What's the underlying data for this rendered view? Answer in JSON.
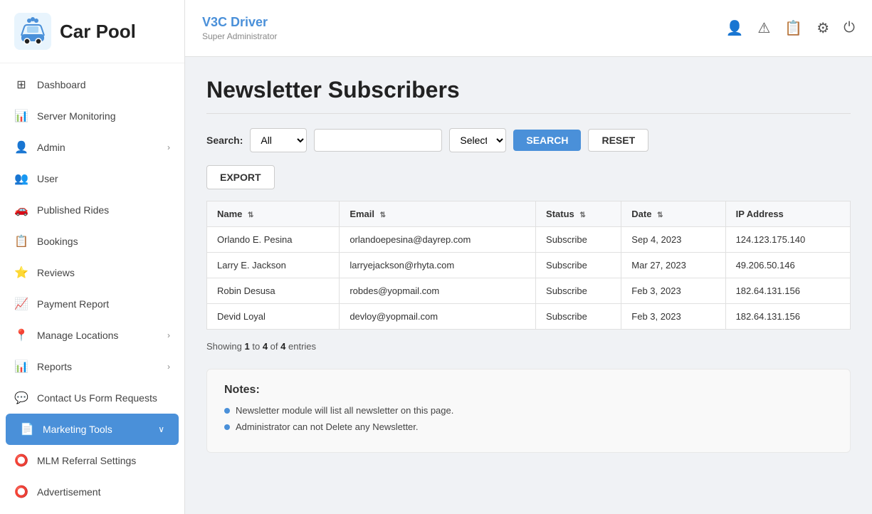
{
  "app": {
    "title": "Car Pool"
  },
  "header": {
    "driver_name": "V3C Driver",
    "role": "Super Administrator"
  },
  "sidebar": {
    "items": [
      {
        "id": "dashboard",
        "label": "Dashboard",
        "icon": "⊞",
        "active": false
      },
      {
        "id": "server-monitoring",
        "label": "Server Monitoring",
        "icon": "📊",
        "active": false
      },
      {
        "id": "admin",
        "label": "Admin",
        "icon": "👤",
        "active": false,
        "has_arrow": true
      },
      {
        "id": "user",
        "label": "User",
        "icon": "👥",
        "active": false
      },
      {
        "id": "published-rides",
        "label": "Published Rides",
        "icon": "🚗",
        "active": false
      },
      {
        "id": "bookings",
        "label": "Bookings",
        "icon": "📋",
        "active": false
      },
      {
        "id": "reviews",
        "label": "Reviews",
        "icon": "👤",
        "active": false
      },
      {
        "id": "payment-report",
        "label": "Payment Report",
        "icon": "📈",
        "active": false
      },
      {
        "id": "manage-locations",
        "label": "Manage Locations",
        "icon": "📍",
        "active": false,
        "has_arrow": true
      },
      {
        "id": "reports",
        "label": "Reports",
        "icon": "📊",
        "active": false,
        "has_arrow": true
      },
      {
        "id": "contact-us",
        "label": "Contact Us Form Requests",
        "icon": "💬",
        "active": false
      },
      {
        "id": "marketing-tools",
        "label": "Marketing Tools",
        "icon": "📄",
        "active": true,
        "has_arrow": true
      },
      {
        "id": "mlm-referral",
        "label": "MLM Referral Settings",
        "icon": "⭕",
        "active": false
      },
      {
        "id": "advertisement",
        "label": "Advertisement",
        "icon": "⭕",
        "active": false
      }
    ]
  },
  "page": {
    "title": "Newsletter Subscribers"
  },
  "search": {
    "label": "Search:",
    "all_option": "All",
    "select_status_placeholder": "Select Status",
    "search_button": "SEARCH",
    "reset_button": "RESET",
    "export_button": "EXPORT"
  },
  "table": {
    "columns": [
      {
        "id": "name",
        "label": "Name",
        "sortable": true
      },
      {
        "id": "email",
        "label": "Email",
        "sortable": true
      },
      {
        "id": "status",
        "label": "Status",
        "sortable": true
      },
      {
        "id": "date",
        "label": "Date",
        "sortable": true
      },
      {
        "id": "ip_address",
        "label": "IP Address",
        "sortable": false
      }
    ],
    "rows": [
      {
        "name": "Orlando E. Pesina",
        "email": "orlandoepesina@dayrep.com",
        "status": "Subscribe",
        "date": "Sep 4, 2023",
        "ip_address": "124.123.175.140"
      },
      {
        "name": "Larry E. Jackson",
        "email": "larryejackson@rhyta.com",
        "status": "Subscribe",
        "date": "Mar 27, 2023",
        "ip_address": "49.206.50.146"
      },
      {
        "name": "Robin Desusa",
        "email": "robdes@yopmail.com",
        "status": "Subscribe",
        "date": "Feb 3, 2023",
        "ip_address": "182.64.131.156"
      },
      {
        "name": "Devid Loyal",
        "email": "devloy@yopmail.com",
        "status": "Subscribe",
        "date": "Feb 3, 2023",
        "ip_address": "182.64.131.156"
      }
    ]
  },
  "pagination": {
    "showing_prefix": "Showing",
    "from": "1",
    "to": "4",
    "of": "of",
    "total": "4",
    "entries_label": "entries"
  },
  "notes": {
    "title": "Notes:",
    "items": [
      "Newsletter module will list all newsletter on this page.",
      "Administrator can not Delete any Newsletter."
    ]
  }
}
